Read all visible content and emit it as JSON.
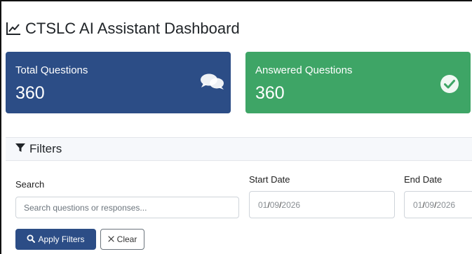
{
  "header": {
    "title": "CTSLC AI Assistant Dashboard",
    "icon": "line-chart-icon"
  },
  "stats": [
    {
      "label": "Total Questions",
      "value": "360",
      "icon": "comments-icon",
      "color": "#2c4d86"
    },
    {
      "label": "Answered Questions",
      "value": "360",
      "icon": "check-circle-icon",
      "color": "#3ea566"
    }
  ],
  "filters": {
    "title": "Filters",
    "icon": "filter-icon",
    "search": {
      "label": "Search",
      "placeholder": "Search questions or responses..."
    },
    "start_date": {
      "label": "Start Date",
      "month": "01",
      "day": "09",
      "year": "2026"
    },
    "end_date": {
      "label": "End Date",
      "month": "01",
      "day": "09",
      "year": "2026"
    },
    "apply_label": "Apply Filters",
    "clear_label": "Clear"
  }
}
